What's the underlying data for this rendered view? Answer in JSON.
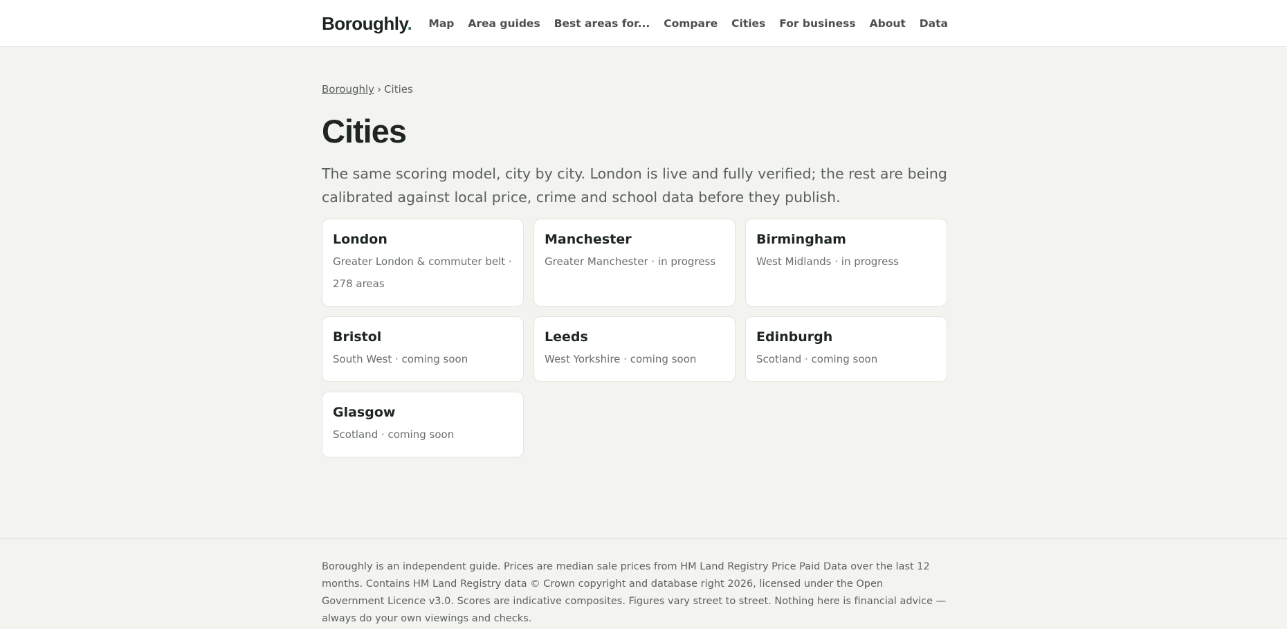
{
  "header": {
    "logo_text": "Boroughly",
    "logo_dot": ".",
    "nav": [
      "Map",
      "Area guides",
      "Best areas for...",
      "Compare",
      "Cities",
      "For business",
      "About",
      "Data"
    ]
  },
  "breadcrumb": {
    "home": "Boroughly",
    "separator": "›",
    "current": "Cities"
  },
  "page": {
    "title": "Cities",
    "lede": "The same scoring model, city by city. London is live and fully verified; the rest are being calibrated against local price, crime and school data before they publish."
  },
  "cities": [
    {
      "name": "London",
      "desc": "Greater London & commuter belt · 278 areas"
    },
    {
      "name": "Manchester",
      "desc": "Greater Manchester · in progress"
    },
    {
      "name": "Birmingham",
      "desc": "West Midlands · in progress"
    },
    {
      "name": "Bristol",
      "desc": "South West · coming soon"
    },
    {
      "name": "Leeds",
      "desc": "West Yorkshire · coming soon"
    },
    {
      "name": "Edinburgh",
      "desc": "Scotland · coming soon"
    },
    {
      "name": "Glasgow",
      "desc": "Scotland · coming soon"
    }
  ],
  "footer": {
    "text": "Boroughly is an independent guide. Prices are median sale prices from HM Land Registry Price Paid Data over the last 12 months. Contains HM Land Registry data © Crown copyright and database right 2026, licensed under the Open Government Licence v3.0. Scores are indicative composites. Figures vary street to street. Nothing here is financial advice — always do your own viewings and checks."
  },
  "colors": {
    "background": "#f3f4f0",
    "card": "#ffffff",
    "accent_dot": "#2f7a4e",
    "text": "#1f2421"
  }
}
